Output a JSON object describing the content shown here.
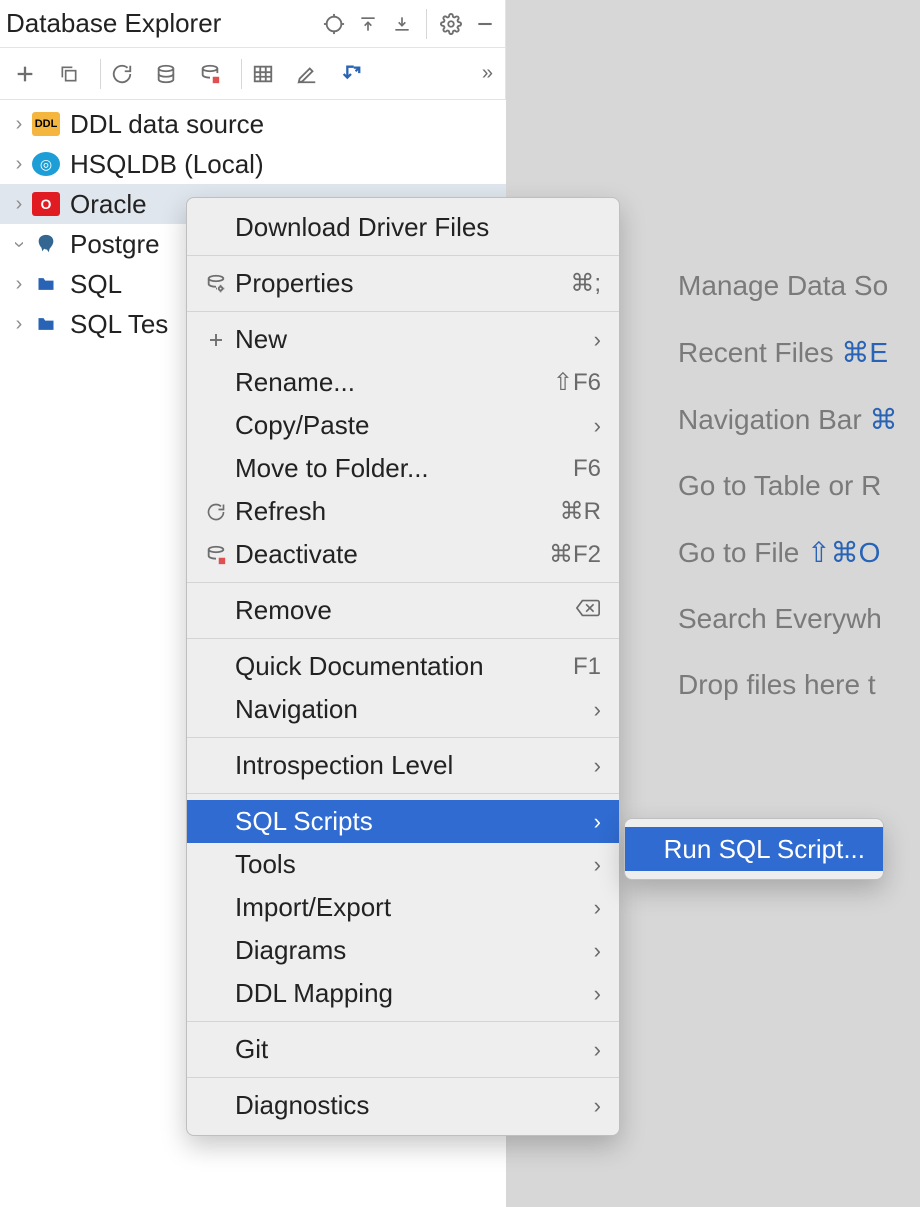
{
  "panel": {
    "title": "Database Explorer"
  },
  "tree": {
    "items": [
      {
        "label": "DDL data source",
        "icon": "ddl",
        "chevron": "right"
      },
      {
        "label": "HSQLDB (Local)",
        "icon": "hsql",
        "chevron": "right"
      },
      {
        "label": "Oracle",
        "icon": "oracle",
        "chevron": "right",
        "selected": true
      },
      {
        "label": "Postgre",
        "icon": "pg",
        "chevron": "down"
      },
      {
        "label": "SQL",
        "icon": "sql",
        "chevron": "right"
      },
      {
        "label": "SQL Tes",
        "icon": "sql",
        "chevron": "right"
      }
    ]
  },
  "context_menu": {
    "groups": [
      [
        {
          "label": "Download Driver Files"
        }
      ],
      [
        {
          "label": "Properties",
          "icon": "props",
          "shortcut": "⌘;"
        }
      ],
      [
        {
          "label": "New",
          "icon": "plus",
          "submenu": true
        },
        {
          "label": "Rename...",
          "shortcut": "⇧F6"
        },
        {
          "label": "Copy/Paste",
          "submenu": true
        },
        {
          "label": "Move to Folder...",
          "shortcut": "F6"
        },
        {
          "label": "Refresh",
          "icon": "refresh",
          "shortcut": "⌘R"
        },
        {
          "label": "Deactivate",
          "icon": "deact",
          "shortcut": "⌘F2"
        }
      ],
      [
        {
          "label": "Remove",
          "right_icon": "backspace"
        }
      ],
      [
        {
          "label": "Quick Documentation",
          "shortcut": "F1"
        },
        {
          "label": "Navigation",
          "submenu": true
        }
      ],
      [
        {
          "label": "Introspection Level",
          "submenu": true
        }
      ],
      [
        {
          "label": "SQL Scripts",
          "submenu": true,
          "highlight": true
        },
        {
          "label": "Tools",
          "submenu": true
        },
        {
          "label": "Import/Export",
          "submenu": true
        },
        {
          "label": "Diagrams",
          "submenu": true
        },
        {
          "label": "DDL Mapping",
          "submenu": true
        }
      ],
      [
        {
          "label": "Git",
          "submenu": true
        }
      ],
      [
        {
          "label": "Diagnostics",
          "submenu": true
        }
      ]
    ]
  },
  "submenu": {
    "items": [
      {
        "label": "Run SQL Script...",
        "highlight": true
      }
    ]
  },
  "hints": [
    {
      "text": "Manage Data So"
    },
    {
      "text": "Recent Files ",
      "shortcut": "⌘E"
    },
    {
      "text": "Navigation Bar ",
      "shortcut": "⌘"
    },
    {
      "text": "Go to Table or R"
    },
    {
      "text": "Go to File ",
      "shortcut": "⇧⌘O"
    },
    {
      "text": "Search Everywh"
    },
    {
      "text": "Drop files here t"
    }
  ]
}
